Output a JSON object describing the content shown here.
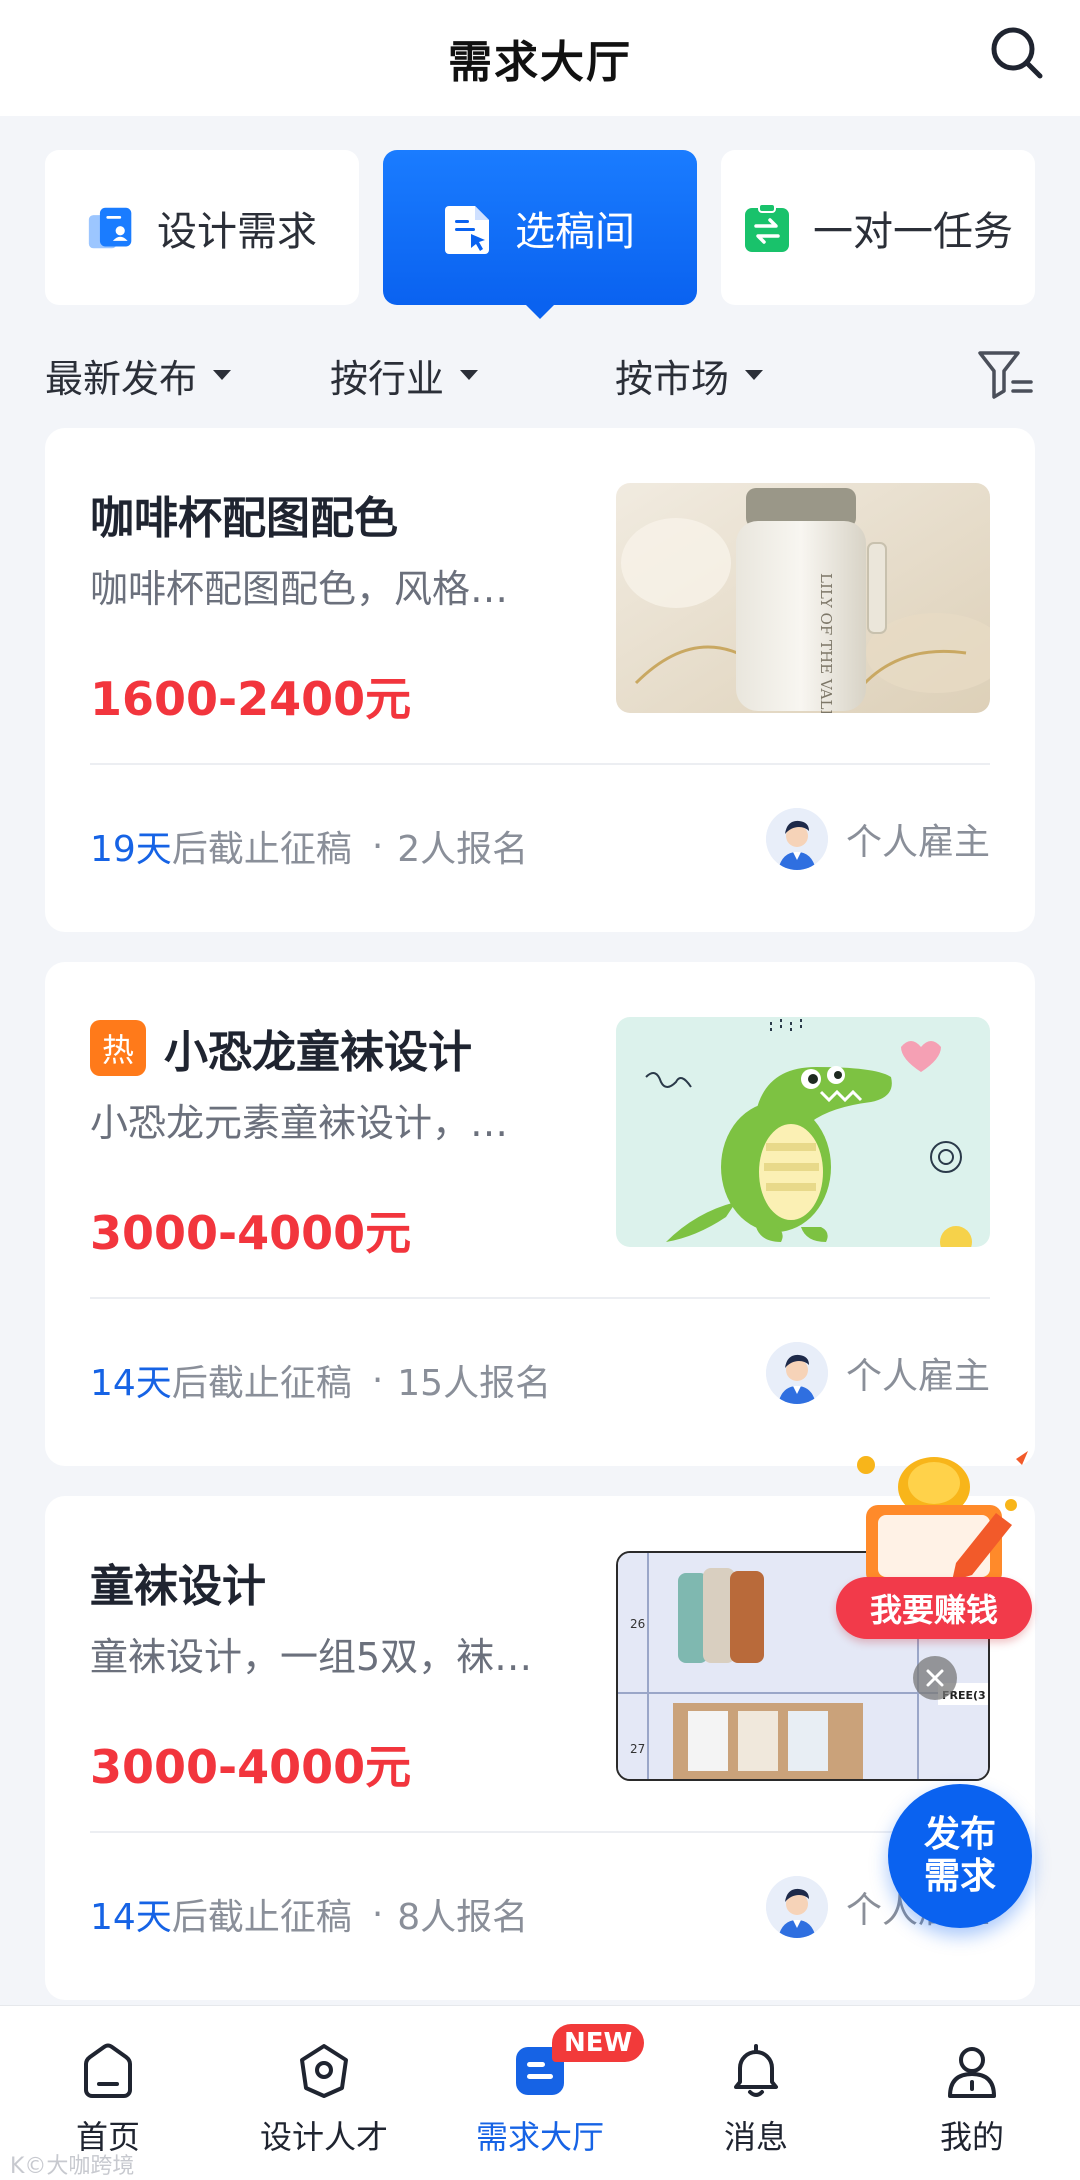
{
  "header": {
    "title": "需求大厅"
  },
  "categories": [
    {
      "label": "设计需求",
      "icon": "design-doc-icon",
      "color": "#1a7cff"
    },
    {
      "label": "选稿间",
      "icon": "file-select-icon",
      "active": true
    },
    {
      "label": "一对一任务",
      "icon": "exchange-icon",
      "color": "#19c26b"
    }
  ],
  "filters": [
    {
      "label": "最新发布"
    },
    {
      "label": "按行业"
    },
    {
      "label": "按市场"
    }
  ],
  "cards": [
    {
      "title": "咖啡杯配图配色",
      "hot": false,
      "desc": "咖啡杯配图配色，风格…",
      "price": "1600-2400元",
      "days": "19天",
      "deadline_suffix": "后截止征稿",
      "signups": "2人报名",
      "employer": "个人雇主",
      "thumb_text": "LILY OF THE VALLEY"
    },
    {
      "title": "小恐龙童袜设计",
      "hot": true,
      "hot_label": "热",
      "desc": "小恐龙元素童袜设计，…",
      "price": "3000-4000元",
      "days": "14天",
      "deadline_suffix": "后截止征稿",
      "signups": "15人报名",
      "employer": "个人雇主"
    },
    {
      "title": "童袜设计",
      "hot": false,
      "desc": "童袜设计，一组5双，袜…",
      "price": "3000-4000元",
      "days": "14天",
      "deadline_suffix": "后截止征稿",
      "signups": "8人报名",
      "employer": "个人雇主",
      "thumb_labels": [
        "26",
        "27",
        "FREE(3"
      ]
    }
  ],
  "floats": {
    "earn_label": "我要赚钱",
    "publish_line1": "发布",
    "publish_line2": "需求"
  },
  "bottom_nav": [
    {
      "label": "首页",
      "icon": "home-icon"
    },
    {
      "label": "设计人才",
      "icon": "talent-icon"
    },
    {
      "label": "需求大厅",
      "icon": "demand-hall-icon",
      "active": true,
      "badge": "NEW"
    },
    {
      "label": "消息",
      "icon": "bell-icon"
    },
    {
      "label": "我的",
      "icon": "user-icon"
    }
  ],
  "watermark": "K©大咖跨境"
}
